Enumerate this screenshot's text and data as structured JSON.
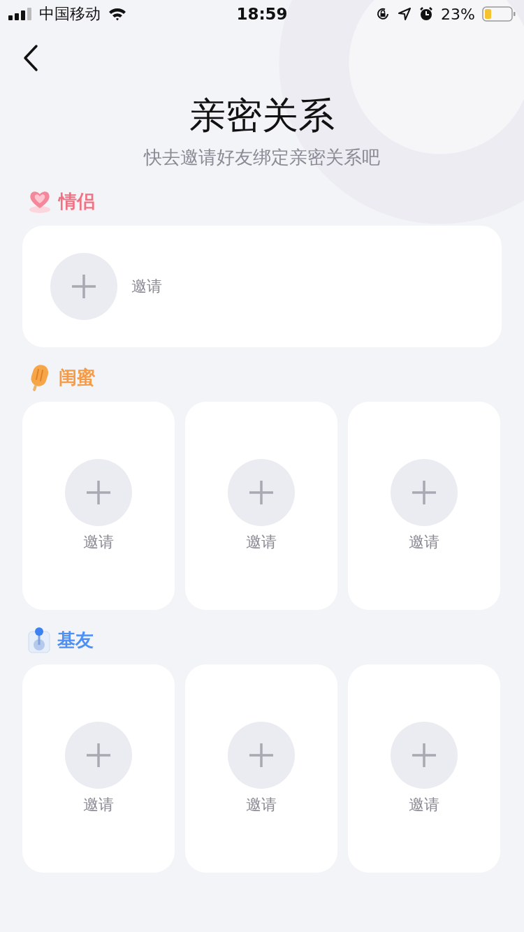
{
  "status_bar": {
    "carrier": "中国移动",
    "time": "18:59",
    "battery": "23%"
  },
  "title": "亲密关系",
  "subtitle": "快去邀请好友绑定亲密关系吧",
  "sections": [
    {
      "title": "情侣",
      "color": "#f07282",
      "kind": "wide",
      "slots": [
        "邀请"
      ]
    },
    {
      "title": "闺蜜",
      "color": "#f59a45",
      "kind": "tall",
      "slots": [
        "邀请",
        "邀请",
        "邀请"
      ]
    },
    {
      "title": "基友",
      "color": "#4d8ff5",
      "kind": "tall",
      "slots": [
        "邀请",
        "邀请",
        "邀请"
      ]
    }
  ]
}
